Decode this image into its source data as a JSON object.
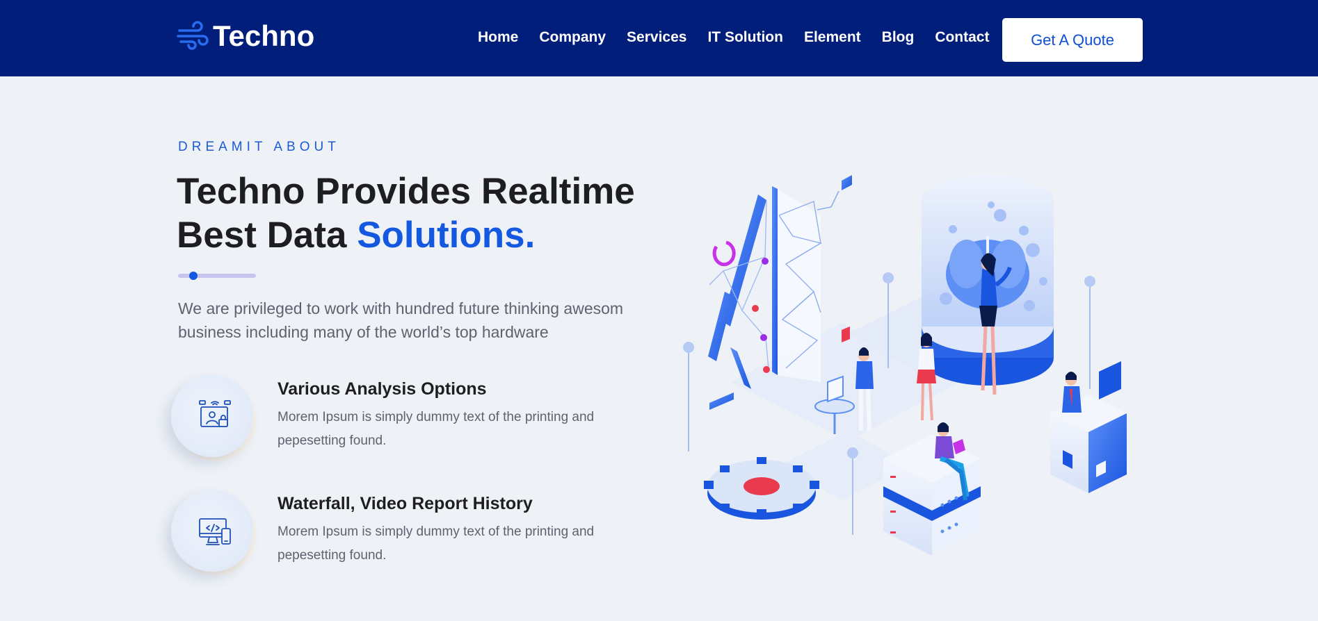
{
  "header": {
    "logo_text": "Techno",
    "nav": [
      "Home",
      "Company",
      "Services",
      "IT Solution",
      "Element",
      "Blog",
      "Contact"
    ],
    "cta_label": "Get A Quote"
  },
  "hero": {
    "eyebrow": "DREAMIT ABOUT",
    "title_line1": "Techno Provides Realtime",
    "title_line2_plain": "Best Data ",
    "title_line2_accent": "Solutions.",
    "description": "We are privileged to work with hundred future thinking awesom business including many of the world’s top hardware"
  },
  "features": [
    {
      "icon": "monitor-user-lock-icon",
      "title": "Various Analysis Options",
      "text": "Morem Ipsum is simply dummy text of the printing and pepesetting found."
    },
    {
      "icon": "monitor-code-mobile-icon",
      "title": "Waterfall, Video Report History",
      "text": "Morem Ipsum is simply dummy text of the printing and pepesetting found."
    }
  ],
  "colors": {
    "header_bg": "#021e7b",
    "accent": "#1558e0",
    "page_bg": "#eef2f7"
  }
}
